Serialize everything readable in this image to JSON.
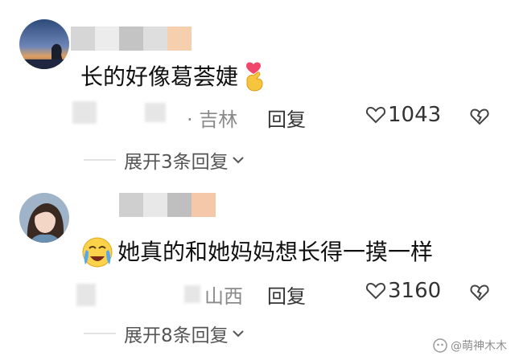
{
  "comments": [
    {
      "text": "长的好像葛荟婕",
      "trailing_emoji": "finger-heart-icon",
      "location": "· 吉林",
      "reply_label": "回复",
      "like_count": "1043",
      "expand_label": "展开3条回复"
    },
    {
      "text": "她真的和她妈妈想长得一摸一样",
      "leading_emoji": "crying-face-icon",
      "location": "山西",
      "reply_label": "回复",
      "like_count": "3160",
      "expand_label": "展开8条回复"
    }
  ],
  "watermark": "@萌神木木",
  "colors": {
    "secondary_text": "#8a8a8a",
    "divider": "#e2e2e2",
    "mosaic": [
      "#c8c8c8",
      "#e4e4e4",
      "#b4b4b4",
      "#d2d2d2",
      "#f4c8a8"
    ]
  }
}
